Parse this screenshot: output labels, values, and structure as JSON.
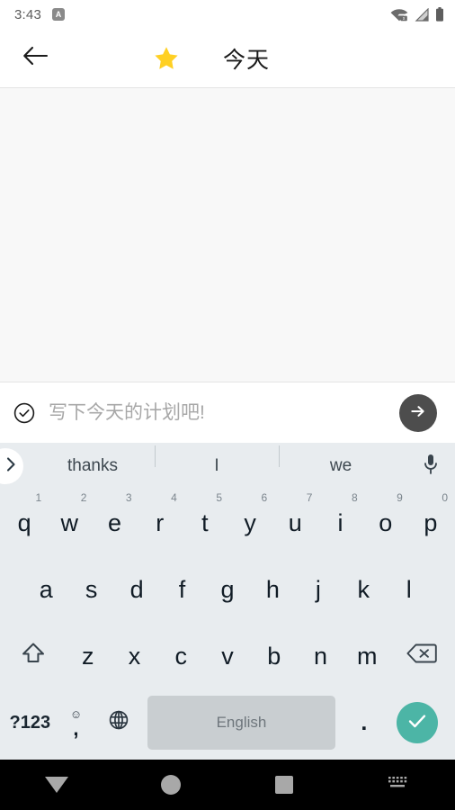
{
  "status_bar": {
    "time": "3:43",
    "badge_label": "A",
    "icons": [
      "wifi-off-icon",
      "cellular-signal-icon",
      "battery-icon"
    ]
  },
  "app_bar": {
    "back_icon": "arrow-left-icon",
    "star_icon": "star-icon",
    "star_color": "#ffd024",
    "title": "今天"
  },
  "content": {
    "background_color": "#f8f8f8",
    "items": []
  },
  "compose": {
    "check_icon": "check-circle-icon",
    "value": "",
    "placeholder": "写下今天的计划吧!",
    "send_icon": "arrow-right-icon",
    "send_button_color": "#4d4d4d"
  },
  "keyboard": {
    "background_color": "#e8ecef",
    "expand_icon": "chevron-right-icon",
    "suggestions": [
      "thanks",
      "I",
      "we"
    ],
    "mic_icon": "microphone-icon",
    "row1": [
      {
        "key": "q",
        "hint": "1"
      },
      {
        "key": "w",
        "hint": "2"
      },
      {
        "key": "e",
        "hint": "3"
      },
      {
        "key": "r",
        "hint": "4"
      },
      {
        "key": "t",
        "hint": "5"
      },
      {
        "key": "y",
        "hint": "6"
      },
      {
        "key": "u",
        "hint": "7"
      },
      {
        "key": "i",
        "hint": "8"
      },
      {
        "key": "o",
        "hint": "9"
      },
      {
        "key": "p",
        "hint": "0"
      }
    ],
    "row2": [
      "a",
      "s",
      "d",
      "f",
      "g",
      "h",
      "j",
      "k",
      "l"
    ],
    "row3": [
      "z",
      "x",
      "c",
      "v",
      "b",
      "n",
      "m"
    ],
    "shift_icon": "shift-up-arrow-icon",
    "backspace_icon": "backspace-delete-icon",
    "symbols_label": "?123",
    "emoji_icon": "smiley-face-icon",
    "comma_label": ",",
    "globe_icon": "globe-language-icon",
    "space_label": "English",
    "period_label": ".",
    "enter_icon": "checkmark-icon",
    "enter_button_color": "#4cb5a6"
  },
  "nav_bar": {
    "back_icon": "triangle-down-hide-keyboard-icon",
    "home_icon": "circle-home-icon",
    "recents_icon": "square-recents-icon",
    "switch_keyboard_icon": "keyboard-switch-icon",
    "background_color": "#000000"
  }
}
